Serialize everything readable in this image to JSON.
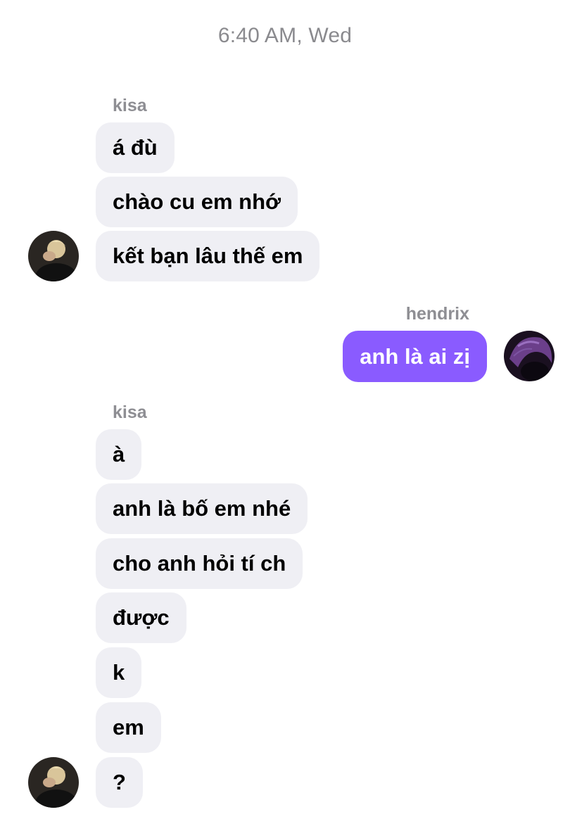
{
  "conversation": {
    "timestamp": "6:40 AM, Wed",
    "groups": [
      {
        "sender": "kisa",
        "side": "incoming",
        "messages": [
          "á đù",
          "chào cu em nhớ",
          "kết bạn lâu thế em"
        ]
      },
      {
        "sender": "hendrix",
        "side": "outgoing",
        "messages": [
          "anh là ai zị"
        ]
      },
      {
        "sender": "kisa",
        "side": "incoming",
        "messages": [
          "à",
          "anh là bố em nhé",
          "cho anh hỏi tí ch",
          "được",
          "k",
          "em",
          "?"
        ]
      }
    ]
  },
  "colors": {
    "incoming_bubble": "#efeff4",
    "outgoing_bubble": "#8a5bff",
    "sender_name": "#8e8e93",
    "timestamp": "#8a8a8e"
  }
}
